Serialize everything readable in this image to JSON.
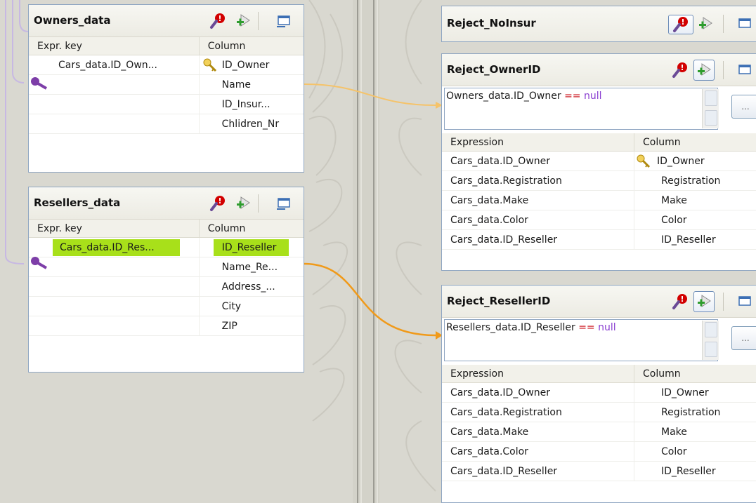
{
  "left_tables": [
    {
      "title": "Owners_data",
      "headers": {
        "expr_key": "Expr. key",
        "column": "Column"
      },
      "rows": [
        {
          "expr": "Cars_data.ID_Own...",
          "column": "ID_Owner",
          "key": true
        },
        {
          "expr": "",
          "column": "Name"
        },
        {
          "expr": "",
          "column": "ID_Insur..."
        },
        {
          "expr": "",
          "column": "Chlidren_Nr"
        }
      ]
    },
    {
      "title": "Resellers_data",
      "headers": {
        "expr_key": "Expr. key",
        "column": "Column"
      },
      "rows": [
        {
          "expr": "Cars_data.ID_Res...",
          "column": "ID_Reseller",
          "highlight": true
        },
        {
          "expr": "",
          "column": "Name_Re..."
        },
        {
          "expr": "",
          "column": "Address_..."
        },
        {
          "expr": "",
          "column": "City"
        },
        {
          "expr": "",
          "column": "ZIP"
        }
      ]
    }
  ],
  "outputs": [
    {
      "title": "Reject_NoInsur"
    },
    {
      "title": "Reject_OwnerID",
      "filter": {
        "left": "Owners_data.ID_Owner",
        "op": "==",
        "right": "null"
      },
      "headers": {
        "expression": "Expression",
        "column": "Column"
      },
      "rows": [
        {
          "expr": "Cars_data.ID_Owner",
          "column": "ID_Owner",
          "key": true
        },
        {
          "expr": "Cars_data.Registration",
          "column": "Registration"
        },
        {
          "expr": "Cars_data.Make",
          "column": "Make"
        },
        {
          "expr": "Cars_data.Color",
          "column": "Color"
        },
        {
          "expr": "Cars_data.ID_Reseller",
          "column": "ID_Reseller"
        }
      ]
    },
    {
      "title": "Reject_ResellerID",
      "filter": {
        "left": "Resellers_data.ID_Reseller",
        "op": "==",
        "right": "null"
      },
      "headers": {
        "expression": "Expression",
        "column": "Column"
      },
      "rows": [
        {
          "expr": "Cars_data.ID_Owner",
          "column": "ID_Owner"
        },
        {
          "expr": "Cars_data.Registration",
          "column": "Registration"
        },
        {
          "expr": "Cars_data.Make",
          "column": "Make"
        },
        {
          "expr": "Cars_data.Color",
          "column": "Color"
        },
        {
          "expr": "Cars_data.ID_Reseller",
          "column": "ID_Reseller"
        }
      ]
    }
  ],
  "buttons": {
    "more": "..."
  },
  "icons": {
    "expression_filter": "magnifier-with-badge-icon",
    "add_filter": "filter-add-icon",
    "minimize": "window-minimize-icon",
    "key": "key-icon"
  },
  "colors": {
    "background": "#d9d8d0",
    "link_orange": "#f5a623",
    "highlight_green": "#a8e01a",
    "lookup_purple": "#7d3ea8",
    "filter_operator": "#c8000a",
    "filter_keyword": "#8a3fd1"
  }
}
